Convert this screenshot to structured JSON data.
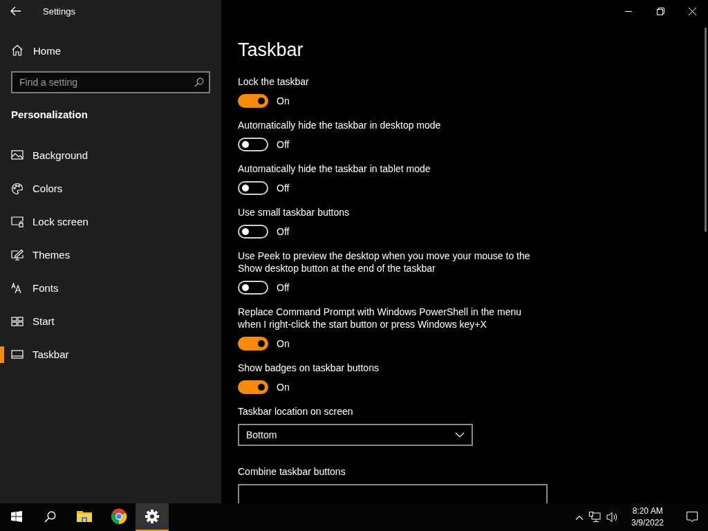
{
  "window": {
    "title": "Settings"
  },
  "sidebar": {
    "home": "Home",
    "search": {
      "placeholder": "Find a setting"
    },
    "section": "Personalization",
    "items": [
      {
        "label": "Background",
        "selected": false
      },
      {
        "label": "Colors",
        "selected": false
      },
      {
        "label": "Lock screen",
        "selected": false
      },
      {
        "label": "Themes",
        "selected": false
      },
      {
        "label": "Fonts",
        "selected": false
      },
      {
        "label": "Start",
        "selected": false
      },
      {
        "label": "Taskbar",
        "selected": true
      }
    ]
  },
  "page": {
    "title": "Taskbar",
    "settings": [
      {
        "kind": "toggle",
        "label": "Lock the taskbar",
        "on": true,
        "state_text": "On"
      },
      {
        "kind": "toggle",
        "label": "Automatically hide the taskbar in desktop mode",
        "on": false,
        "state_text": "Off"
      },
      {
        "kind": "toggle",
        "label": "Automatically hide the taskbar in tablet mode",
        "on": false,
        "state_text": "Off"
      },
      {
        "kind": "toggle",
        "label": "Use small taskbar buttons",
        "on": false,
        "state_text": "Off"
      },
      {
        "kind": "toggle",
        "label": "Use Peek to preview the desktop when you move your mouse to the Show desktop button at the end of the taskbar",
        "on": false,
        "state_text": "Off"
      },
      {
        "kind": "toggle",
        "label": "Replace Command Prompt with Windows PowerShell in the menu when I right-click the start button or press Windows key+X",
        "on": true,
        "state_text": "On"
      },
      {
        "kind": "toggle",
        "label": "Show badges on taskbar buttons",
        "on": true,
        "state_text": "On"
      },
      {
        "kind": "dropdown",
        "label": "Taskbar location on screen",
        "value": "Bottom"
      },
      {
        "kind": "dropdown",
        "label": "Combine taskbar buttons"
      }
    ]
  },
  "taskbar": {
    "apps": [
      {
        "kind": "start",
        "selected": false
      },
      {
        "kind": "search",
        "selected": false
      },
      {
        "kind": "folder",
        "selected": false
      },
      {
        "kind": "browser",
        "selected": false
      },
      {
        "kind": "settings",
        "selected": true
      }
    ],
    "clock": {
      "time": "8:20 AM",
      "date": "3/9/2022"
    }
  }
}
